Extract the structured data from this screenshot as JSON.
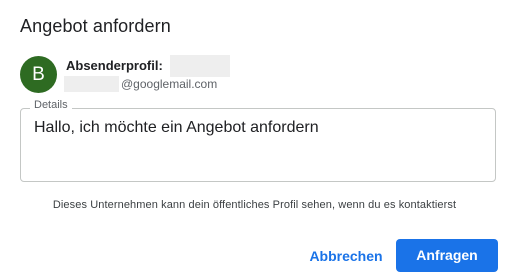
{
  "dialog": {
    "title": "Angebot anfordern"
  },
  "sender": {
    "avatar_initial": "B",
    "avatar_color": "#2e6b22",
    "label": "Absenderprofil:",
    "email_domain": "@googlemail.com"
  },
  "details": {
    "legend": "Details",
    "value": "Hallo, ich möchte ein Angebot anfordern"
  },
  "notice": "Dieses Unternehmen kann dein öffentliches Profil sehen, wenn du es kontaktierst",
  "actions": {
    "cancel_label": "Abbrechen",
    "submit_label": "Anfragen",
    "accent_color": "#1a73e8"
  }
}
